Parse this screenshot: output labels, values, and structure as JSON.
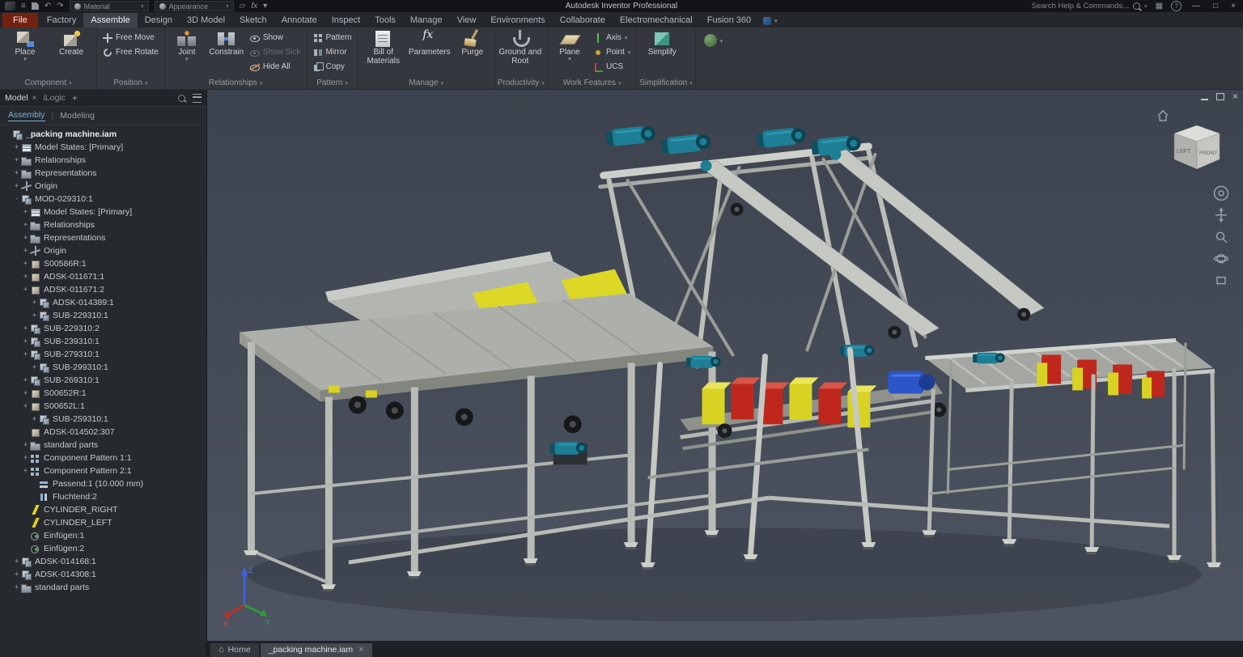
{
  "titlebar": {
    "title": "Autodesk Inventor Professional",
    "material": "Material",
    "appearance": "Appearance",
    "search": "Search Help & Commands..."
  },
  "ribbon_tabs": [
    {
      "label": "File",
      "file": true
    },
    {
      "label": "Factory"
    },
    {
      "label": "Assemble",
      "active": true
    },
    {
      "label": "Design"
    },
    {
      "label": "3D Model"
    },
    {
      "label": "Sketch"
    },
    {
      "label": "Annotate"
    },
    {
      "label": "Inspect"
    },
    {
      "label": "Tools"
    },
    {
      "label": "Manage"
    },
    {
      "label": "View"
    },
    {
      "label": "Environments"
    },
    {
      "label": "Collaborate"
    },
    {
      "label": "Electromechanical"
    },
    {
      "label": "Fusion 360"
    }
  ],
  "ribbon": {
    "component": {
      "place": "Place",
      "create": "Create",
      "label": "Component"
    },
    "position": {
      "free_move": "Free Move",
      "free_rotate": "Free Rotate",
      "label": "Position"
    },
    "relationships": {
      "joint": "Joint",
      "constrain": "Constrain",
      "show": "Show",
      "show_sick": "Show Sick",
      "hide_all": "Hide All",
      "label": "Relationships"
    },
    "pattern": {
      "pattern": "Pattern",
      "mirror": "Mirror",
      "copy": "Copy",
      "label": "Pattern"
    },
    "manage": {
      "bom": "Bill of Materials",
      "parameters": "Parameters",
      "purge": "Purge",
      "label": "Manage"
    },
    "productivity": {
      "ground_root": "Ground and Root",
      "label": "Productivity"
    },
    "work_features": {
      "plane": "Plane",
      "axis": "Axis",
      "point": "Point",
      "ucs": "UCS",
      "label": "Work Features"
    },
    "simplification": {
      "simplify": "Simplify",
      "label": "Simplification"
    }
  },
  "browser": {
    "tab_model": "Model",
    "tab_ilogic": "iLogic",
    "subtab_assembly": "Assembly",
    "subtab_modeling": "Modeling",
    "tree": [
      {
        "t": "_packing machine.iam",
        "l": 0,
        "e": "",
        "i": "root",
        "b": true
      },
      {
        "t": "Model States: [Primary]",
        "l": 1,
        "e": "+",
        "i": "states"
      },
      {
        "t": "Relationships",
        "l": 1,
        "e": "+",
        "i": "folder"
      },
      {
        "t": "Representations",
        "l": 1,
        "e": "+",
        "i": "folder"
      },
      {
        "t": "Origin",
        "l": 1,
        "e": "+",
        "i": "origin"
      },
      {
        "t": "MOD-029310:1",
        "l": 1,
        "e": "-",
        "i": "asm"
      },
      {
        "t": "Model States: [Primary]",
        "l": 2,
        "e": "+",
        "i": "states"
      },
      {
        "t": "Relationships",
        "l": 2,
        "e": "+",
        "i": "folder"
      },
      {
        "t": "Representations",
        "l": 2,
        "e": "+",
        "i": "folder"
      },
      {
        "t": "Origin",
        "l": 2,
        "e": "+",
        "i": "origin"
      },
      {
        "t": "S00586R:1",
        "l": 2,
        "e": "+",
        "i": "part"
      },
      {
        "t": "ADSK-011671:1",
        "l": 2,
        "e": "+",
        "i": "part"
      },
      {
        "t": "ADSK-011671:2",
        "l": 2,
        "e": "+",
        "i": "part"
      },
      {
        "t": "ADSK-014389:1",
        "l": 3,
        "e": "+",
        "i": "asm"
      },
      {
        "t": "SUB-229310:1",
        "l": 3,
        "e": "+",
        "i": "asm"
      },
      {
        "t": "SUB-229310:2",
        "l": 2,
        "e": "+",
        "i": "asm"
      },
      {
        "t": "SUB-239310:1",
        "l": 2,
        "e": "+",
        "i": "asm"
      },
      {
        "t": "SUB-279310:1",
        "l": 2,
        "e": "+",
        "i": "asm"
      },
      {
        "t": "SUB-299310:1",
        "l": 3,
        "e": "+",
        "i": "asm"
      },
      {
        "t": "SUB-269310:1",
        "l": 2,
        "e": "+",
        "i": "asm"
      },
      {
        "t": "S00652R:1",
        "l": 2,
        "e": "+",
        "i": "part"
      },
      {
        "t": "S00652L:1",
        "l": 2,
        "e": "+",
        "i": "part"
      },
      {
        "t": "SUB-259310:1",
        "l": 3,
        "e": "+",
        "i": "asm"
      },
      {
        "t": "ADSK-014502:307",
        "l": 2,
        "e": "",
        "i": "part"
      },
      {
        "t": "standard parts",
        "l": 2,
        "e": "+",
        "i": "folder"
      },
      {
        "t": "Component Pattern 1:1",
        "l": 2,
        "e": "+",
        "i": "pattern"
      },
      {
        "t": "Component Pattern 2:1",
        "l": 2,
        "e": "+",
        "i": "pattern"
      },
      {
        "t": "Passend:1 (10.000 mm)",
        "l": 3,
        "e": "",
        "i": "mate"
      },
      {
        "t": "Fluchtend:2",
        "l": 3,
        "e": "",
        "i": "flush"
      },
      {
        "t": "CYLINDER_RIGHT",
        "l": 2,
        "e": "",
        "i": "bolt"
      },
      {
        "t": "CYLINDER_LEFT",
        "l": 2,
        "e": "",
        "i": "bolt"
      },
      {
        "t": "Einfügen:1",
        "l": 2,
        "e": "",
        "i": "insert"
      },
      {
        "t": "Einfügen:2",
        "l": 2,
        "e": "",
        "i": "insert"
      },
      {
        "t": "ADSK-014168:1",
        "l": 1,
        "e": "+",
        "i": "asm"
      },
      {
        "t": "ADSK-014308:1",
        "l": 1,
        "e": "+",
        "i": "asm"
      },
      {
        "t": "standard parts",
        "l": 1,
        "e": "+",
        "i": "folder"
      }
    ]
  },
  "viewport": {
    "viewcube": {
      "left": "LEFT",
      "front": "FRONT"
    },
    "triad": {
      "x": "X",
      "y": "Y",
      "z": "Z"
    }
  },
  "bottom": {
    "tabs": [
      {
        "label": "Home",
        "icon": "home"
      },
      {
        "label": "_packing machine.iam",
        "active": true,
        "close": true
      }
    ]
  }
}
